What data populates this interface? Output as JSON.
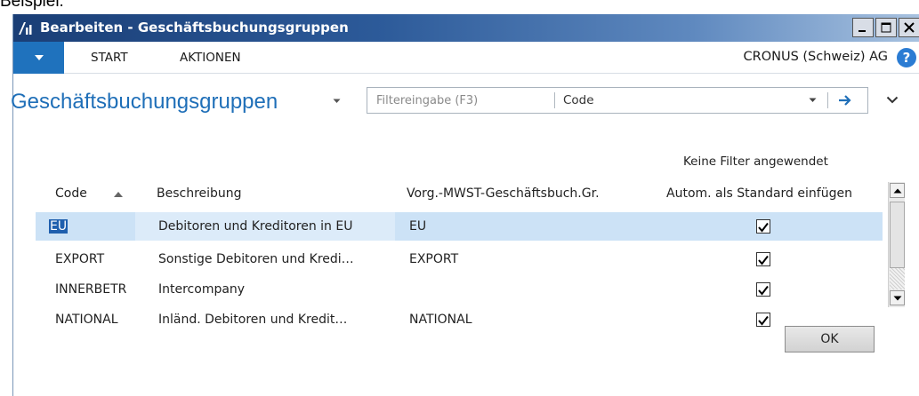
{
  "caption": "Beispiel:",
  "window": {
    "title": "Bearbeiten - Geschäftsbuchungsgruppen",
    "controls": [
      "minimize-icon",
      "maximize-icon",
      "close-icon"
    ]
  },
  "ribbon": {
    "tabs": [
      "START",
      "AKTIONEN"
    ],
    "company": "CRONUS (Schweiz) AG",
    "help": "?"
  },
  "page": {
    "title": "Geschäftsbuchungsgruppen"
  },
  "filter": {
    "placeholder": "Filtereingabe (F3)",
    "value": "",
    "field": "Code",
    "status": "Keine Filter angewendet"
  },
  "table": {
    "columns": [
      "Code",
      "Beschreibung",
      "Vorg.-MWST-Geschäftsbuch.Gr.",
      "Autom. als Standard einfügen"
    ],
    "sort": "ascending",
    "rows": [
      {
        "code": "EU",
        "description": "Debitoren und Kreditoren in EU",
        "vat_group": "EU",
        "auto_insert": true,
        "selected": true
      },
      {
        "code": "EXPORT",
        "description": "Sonstige Debitoren und Kredi…",
        "vat_group": "EXPORT",
        "auto_insert": true,
        "selected": false
      },
      {
        "code": "INNERBETR",
        "description": "Intercompany",
        "vat_group": "",
        "auto_insert": true,
        "selected": false
      },
      {
        "code": "NATIONAL",
        "description": "Inländ. Debitoren und Kredit…",
        "vat_group": "NATIONAL",
        "auto_insert": true,
        "selected": false
      }
    ]
  },
  "buttons": {
    "ok": "OK"
  },
  "colors": {
    "accent": "#1f72bd",
    "title_blue": "#1f6fb8",
    "selected_row": "#cce2f6"
  }
}
